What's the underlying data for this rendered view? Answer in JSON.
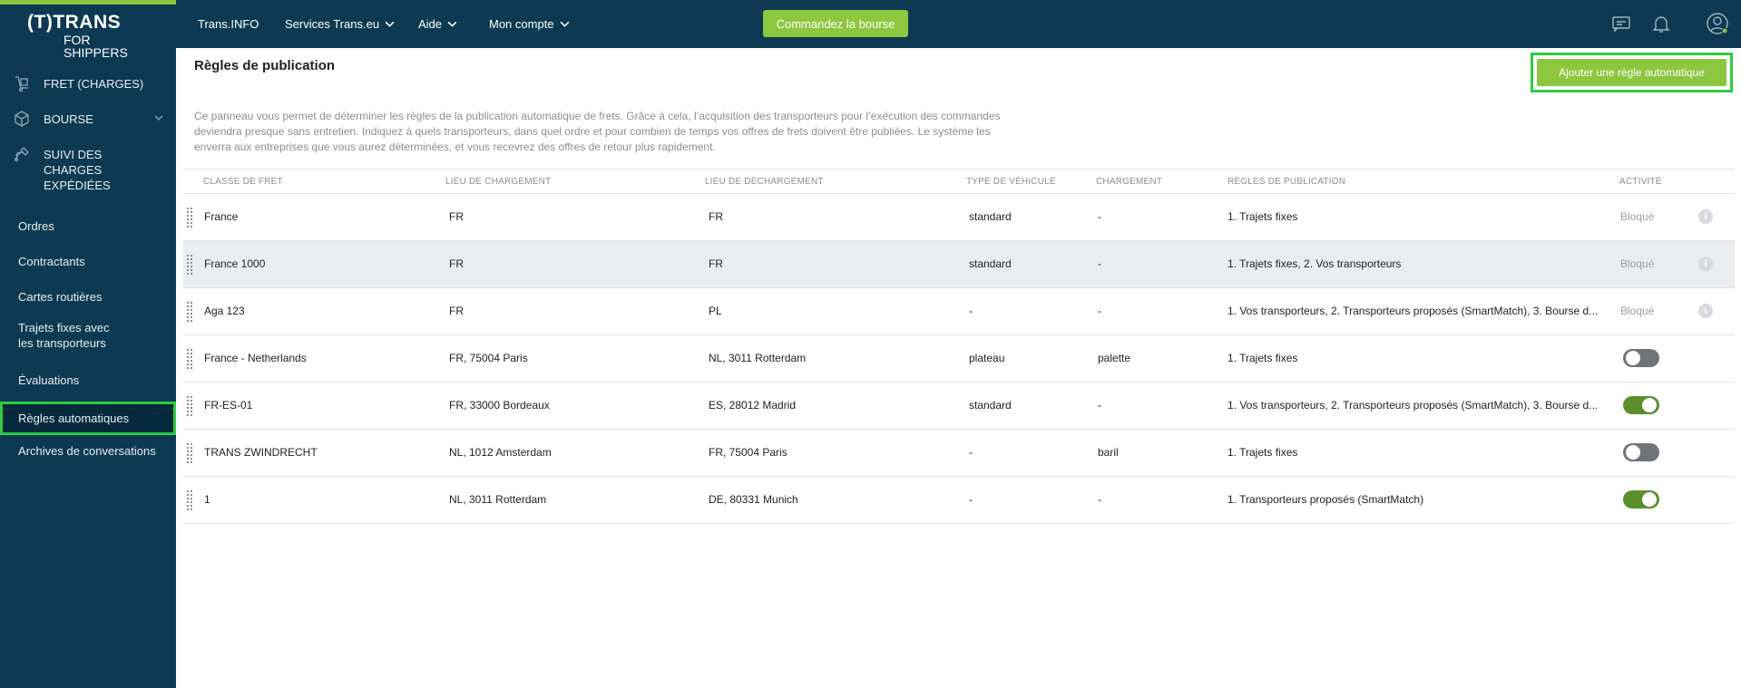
{
  "brand": {
    "line1": "(T)TRANS",
    "line2": "FOR SHIPPERS"
  },
  "sidebar": {
    "main_items": [
      {
        "label": "FRET (CHARGES)",
        "icon": "cargo-icon"
      },
      {
        "label": "BOURSE",
        "icon": "box-icon"
      },
      {
        "label": "SUIVI DES CHARGES EXPÉDIÉES",
        "icon": "tracking-icon"
      }
    ],
    "sub_items": [
      {
        "label": "Ordres"
      },
      {
        "label": "Contractants"
      },
      {
        "label": "Cartes routières"
      },
      {
        "label": "Trajets fixes avec les transporteurs"
      },
      {
        "label": "Évaluations"
      },
      {
        "label": "Règles automatiques",
        "active": true
      },
      {
        "label": "Archives de conversations"
      }
    ]
  },
  "topbar": {
    "nav": [
      "Trans.INFO",
      "Services Trans.eu",
      "Aide",
      "Mon compte"
    ],
    "order_button": "Commandez la bourse"
  },
  "page": {
    "title": "Règles de publication",
    "add_button": "Ajouter une règle automatique",
    "description": "Ce panneau vous permet de déterminer les règles de la publication automatique de frets. Grâce à cela, l’acquisition des transporteurs pour l’exécution des commandes deviendra presque sans entretien. Indiquez à quels transporteurs, dans quel ordre et pour combien de temps vos offres de frets doivent être publiées. Le système les enverra aux entreprises que vous aurez déterminées, et vous recevrez des offres de retour plus rapidement."
  },
  "table": {
    "headers": [
      "CLASSE DE FRET",
      "LIEU DE CHARGEMENT",
      "LIEU DE DÉCHARGEMENT",
      "TYPE DE VÉHICULE",
      "CHARGEMENT",
      "RÈGLES DE PUBLICATION",
      "ACTIVITÉ"
    ],
    "rows": [
      {
        "classe": "France",
        "chargement_lieu": "FR",
        "dechargement": "FR",
        "vehicule": "standard",
        "chargement": "-",
        "regles": "1. Trajets fixes",
        "activite": "Bloqué",
        "state": "blocked"
      },
      {
        "classe": "France 1000",
        "chargement_lieu": "FR",
        "dechargement": "FR",
        "vehicule": "standard",
        "chargement": "-",
        "regles": "1. Trajets fixes, 2. Vos transporteurs",
        "activite": "Bloqué",
        "state": "blocked"
      },
      {
        "classe": "Aga 123",
        "chargement_lieu": "FR",
        "dechargement": "PL",
        "vehicule": "-",
        "chargement": "-",
        "regles": "1. Vos transporteurs, 2. Transporteurs proposés (SmartMatch), 3. Bourse d...",
        "activite": "Bloqué",
        "state": "blocked"
      },
      {
        "classe": "France - Netherlands",
        "chargement_lieu": "FR, 75004 Paris",
        "dechargement": "NL, 3011 Rotterdam",
        "vehicule": "plateau",
        "chargement": "palette",
        "regles": "1. Trajets fixes",
        "activite": "",
        "state": "off"
      },
      {
        "classe": "FR-ES-01",
        "chargement_lieu": "FR, 33000 Bordeaux",
        "dechargement": "ES, 28012 Madrid",
        "vehicule": "standard",
        "chargement": "-",
        "regles": "1. Vos transporteurs, 2. Transporteurs proposés (SmartMatch), 3. Bourse d...",
        "activite": "",
        "state": "on"
      },
      {
        "classe": "TRANS ZWINDRECHT",
        "chargement_lieu": "NL, 1012 Amsterdam",
        "dechargement": "FR, 75004 Paris",
        "vehicule": "-",
        "chargement": "baril",
        "regles": "1. Trajets fixes",
        "activite": "",
        "state": "off"
      },
      {
        "classe": "1",
        "chargement_lieu": "NL, 3011 Rotterdam",
        "dechargement": "DE, 80331 Munich",
        "vehicule": "-",
        "chargement": "-",
        "regles": "1. Transporteurs proposés (SmartMatch)",
        "activite": "",
        "state": "on"
      }
    ]
  },
  "colors": {
    "sidebar": "#0d3a52",
    "accent_green": "#8dc63f",
    "highlight_frame": "#2ecc40",
    "toggle_on": "#5a8f2b"
  }
}
